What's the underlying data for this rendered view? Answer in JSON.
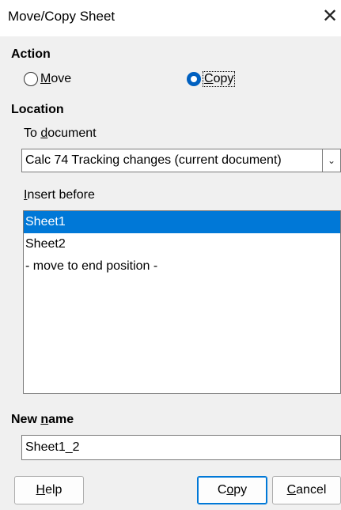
{
  "dialog": {
    "title": "Move/Copy Sheet",
    "close_glyph": "✕"
  },
  "action": {
    "heading": "Action",
    "move_label": "Move",
    "copy_label": "Copy",
    "selected": "copy"
  },
  "location": {
    "heading": "Location",
    "to_document_label": "To document",
    "document_value": "Calc 74 Tracking changes (current document)",
    "insert_before_label": "Insert before",
    "insert_before_items": [
      "Sheet1",
      "Sheet2",
      "- move to end position -"
    ],
    "selected_index": 0
  },
  "new_name": {
    "label": "New name",
    "value": "Sheet1_2"
  },
  "buttons": {
    "help": "Help",
    "copy": "Copy",
    "cancel": "Cancel"
  },
  "colors": {
    "accent": "#0078d7",
    "radio_checked": "#0060c0",
    "background": "#f0f0f0"
  }
}
